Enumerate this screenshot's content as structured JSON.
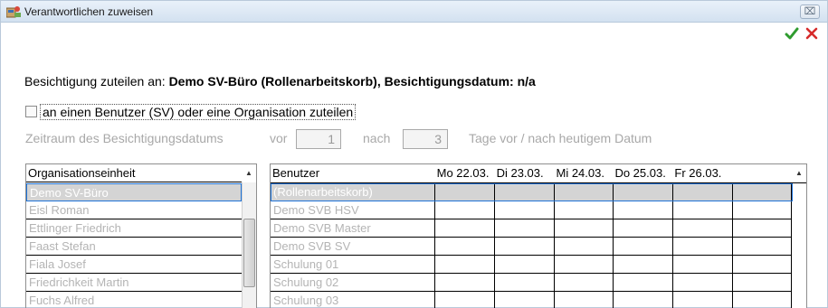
{
  "window": {
    "title": "Verantwortlichen zuweisen",
    "close_glyph": "⌧"
  },
  "actions": {
    "confirm_icon": "check-icon",
    "cancel_icon": "cancel-icon",
    "confirm_color": "#2e9b2e",
    "cancel_color": "#d62b2b"
  },
  "assignment": {
    "prefix": "Besichtigung zuteilen an: ",
    "target": "Demo SV-Büro (Rollenarbeitskorb), Besichtigungsdatum: n/a"
  },
  "option": {
    "label": "an einen Benutzer (SV) oder eine Organisation zuteilen",
    "checked": false
  },
  "period": {
    "label": "Zeitraum des Besichtigungsdatums",
    "before_label": "vor",
    "before_value": "1",
    "after_label": "nach",
    "after_value": "3",
    "suffix": "Tage vor / nach heutigem Datum"
  },
  "org_list": {
    "header": "Organisationseinheit",
    "sort_glyph": "▲",
    "items": [
      "Demo SV-Büro",
      "Eisl Roman",
      "Ettlinger Friedrich",
      "Faast Stefan",
      "Fiala Josef",
      "Friedrichkeit Martin",
      "Fuchs Alfred"
    ],
    "selected_index": 0
  },
  "user_grid": {
    "headers": [
      "Benutzer",
      "Mo 22.03.",
      "Di 23.03.",
      "Mi 24.03.",
      "Do 25.03.",
      "Fr 26.03.",
      ""
    ],
    "sort_glyph": "▲",
    "rows": [
      "(Rollenarbeitskorb)",
      "Demo SVB HSV",
      "Demo SVB Master",
      "Demo SVB SV",
      "Schulung 01",
      "Schulung 02",
      "Schulung 03"
    ],
    "selected_index": 0
  }
}
